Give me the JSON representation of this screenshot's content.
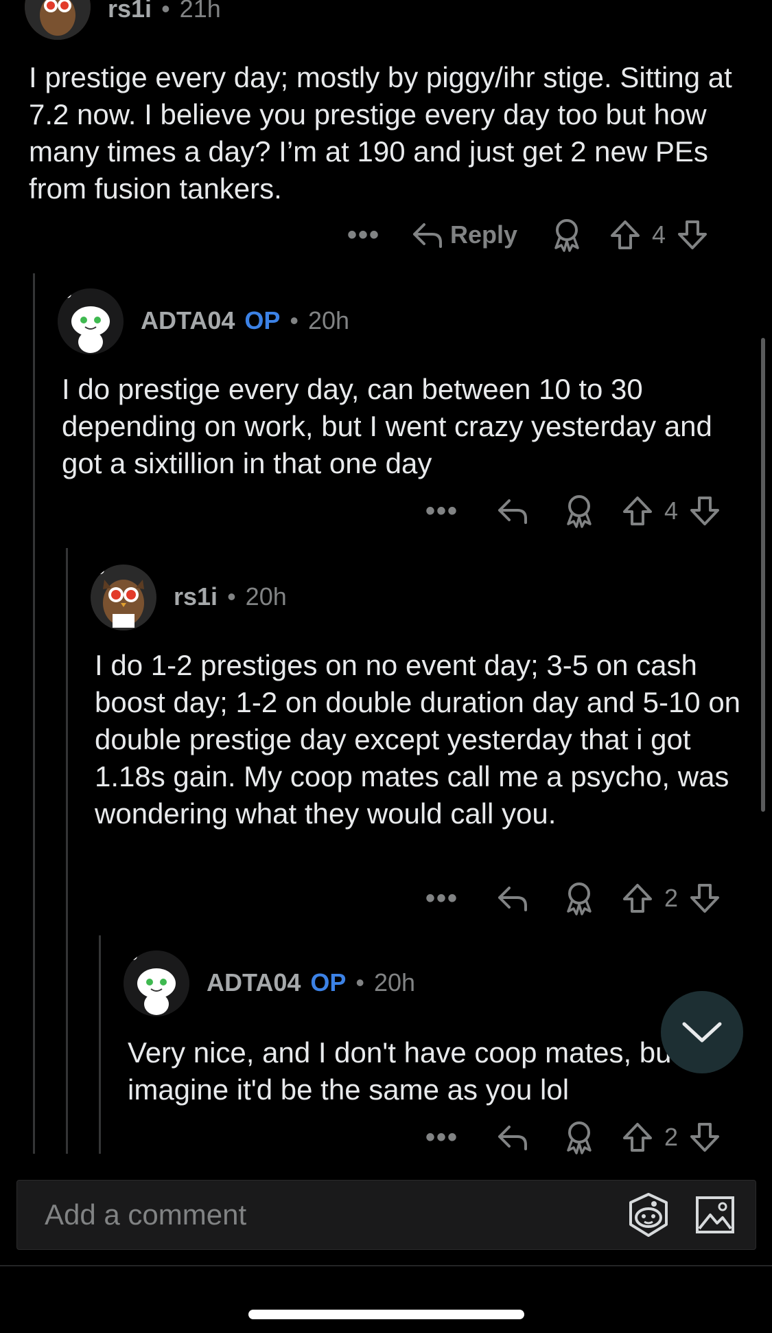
{
  "comments": [
    {
      "user": "rs1i",
      "time": "21h",
      "body": "I prestige every day; mostly by piggy/ihr stige. Sitting at 7.2 now. I believe you prestige every day too but how many times a day?  I’m at 190 and just get 2 new PEs from fusion tankers.",
      "reply_label": "Reply",
      "votes": "4",
      "avatar": "owl-avatar"
    },
    {
      "user": "ADTA04",
      "op_badge": "OP",
      "time": "20h",
      "body": "I do prestige every day, can between 10 to 30 depending on work, but I went crazy yesterday and got a sixtillion in that one day",
      "votes": "4",
      "avatar": "snoo-avatar"
    },
    {
      "user": "rs1i",
      "time": "20h",
      "body": "I do 1-2 prestiges on no event day; 3-5 on cash boost day; 1-2 on double duration day and 5-10 on double prestige day except yesterday that i got 1.18s gain. My coop mates call me a psycho, was wondering what they would call you.",
      "votes": "2",
      "avatar": "owl-avatar"
    },
    {
      "user": "ADTA04",
      "op_badge": "OP",
      "time": "20h",
      "body": "Very nice, and I don't have coop mates, but I'd imagine it'd be the same as you lol",
      "votes": "2",
      "avatar": "snoo-avatar"
    }
  ],
  "separator": "•",
  "more_label": "•••",
  "composer": {
    "placeholder": "Add a comment"
  },
  "icons": [
    "reply-icon",
    "award-icon",
    "upvote-icon",
    "downvote-icon",
    "snoo-icon",
    "image-icon",
    "chevron-down-icon"
  ],
  "colors": {
    "background": "#000000",
    "op": "#3c82e6",
    "muted": "#818384",
    "text": "#e8eaec"
  }
}
